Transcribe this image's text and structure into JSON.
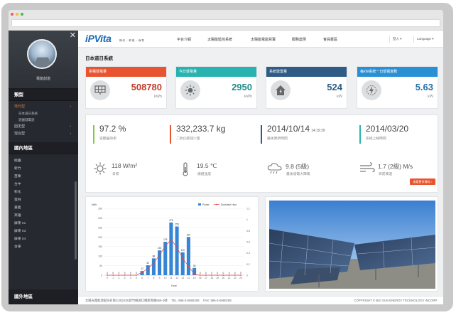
{
  "colors": {
    "accent_red": "#e8542f",
    "accent_teal": "#28b3b0",
    "accent_navy": "#2e5c86",
    "accent_blue": "#2a90d6",
    "bar_blue": "#3585d5",
    "line_red": "#e04646",
    "brand_blue": "#1a6ab5"
  },
  "sidebar": {
    "site_name": "電能創道",
    "section_type": "類型",
    "type_items": [
      {
        "label": "地日型",
        "sub": [
          "日本道日系統",
          "遊園儲電遊"
        ]
      },
      {
        "label": "固定型"
      },
      {
        "label": "混合型"
      }
    ],
    "section_domestic": "國內地區",
    "regions": [
      "桃園",
      "新竹",
      "苗栗",
      "台中",
      "彰化",
      "雲林",
      "嘉義",
      "高雄",
      "屏東 01",
      "屏東 03",
      "屏東 04",
      "台東"
    ],
    "section_overseas": "國外地區"
  },
  "topnav": {
    "logo": "iPVita",
    "logo_tagline": "節 約 ・ 節 能 ・ 綠 電",
    "items": [
      "平台介紹",
      "太陽能監控系統",
      "太陽能電能買賣",
      "服務案例",
      "會員專區"
    ],
    "login": "登入 ▾",
    "language": "Language ▾"
  },
  "page_title": "日本道日系統",
  "tiles": [
    {
      "title": "累積發電量",
      "value": "508780",
      "unit": "kWh",
      "color": "#e8542f",
      "value_color": "#c43a2a",
      "icon": "solar-panel-icon"
    },
    {
      "title": "今日發電量",
      "value": "2950",
      "unit": "kWh",
      "color": "#28b3b0",
      "value_color": "#1f8c89",
      "icon": "sun-icon"
    },
    {
      "title": "系統建置量",
      "value": "524",
      "unit": "kW",
      "color": "#2e5c86",
      "value_color": "#2e5c86",
      "icon": "house-icon"
    },
    {
      "title": "每kW系統一日發電度數",
      "value": "5.63",
      "unit": "kW",
      "color": "#2a90d6",
      "value_color": "#2470a8",
      "icon": "lightning-icon"
    }
  ],
  "stats": [
    {
      "value": "97.2 %",
      "time": "",
      "label": "逆變器效率",
      "color": "#8bc34a"
    },
    {
      "value": "332,233.7 kg",
      "time": "",
      "label": "二氧化碳減少量",
      "color": "#e8542f"
    },
    {
      "value": "2014/10/14",
      "time": "14:19:39",
      "label": "最後更新時間",
      "color": "#2e5c86"
    },
    {
      "value": "2014/03/20",
      "time": "",
      "label": "系統上線時間",
      "color": "#28b3b0"
    }
  ],
  "weather": [
    {
      "value": "118 W/m²",
      "label": "日照",
      "icon": "sun-outline-icon"
    },
    {
      "value": "19.5 ℃",
      "label": "模組溫度",
      "icon": "thermometer-icon"
    },
    {
      "value": "9.8 (5級)",
      "label": "最後發電大陣風",
      "icon": "cloud-rain-icon"
    },
    {
      "value": "1.7 (2級) M/s",
      "label": "目前風速",
      "icon": "wind-icon"
    }
  ],
  "more_button": "查看更多資料 ›",
  "chart_data": {
    "type": "bar",
    "title": "",
    "ylabel": "kWh",
    "xlabel": "Hour",
    "ylim": [
      0,
      350
    ],
    "y2lim": [
      0,
      1.2
    ],
    "legend": {
      "placement": "top-right"
    },
    "categories": [
      "0",
      "1",
      "2",
      "3",
      "4",
      "5",
      "6",
      "7",
      "8",
      "9",
      "10",
      "11",
      "12",
      "13",
      "14",
      "15",
      "16",
      "17",
      "18",
      "19",
      "20",
      "21",
      "22",
      "23"
    ],
    "series": [
      {
        "name": "Power",
        "type": "bar",
        "values": [
          0,
          0,
          0,
          0,
          0,
          0,
          22,
          52,
          88,
          130,
          175,
          276,
          255,
          120,
          200,
          38,
          0,
          0,
          0,
          0,
          0,
          0,
          0,
          0
        ]
      },
      {
        "name": "Sunshine Hour",
        "type": "line",
        "axis": "right",
        "values": [
          0,
          0,
          0,
          0,
          0,
          0,
          0.05,
          0.12,
          0.22,
          0.36,
          0.52,
          0.64,
          0.5,
          0.3,
          0.16,
          0.02,
          0,
          0,
          0,
          0,
          0,
          0,
          0,
          0
        ]
      }
    ],
    "yticks": [
      "0",
      "50",
      "100",
      "150",
      "200",
      "250",
      "300",
      "350"
    ],
    "y2ticks": [
      "0",
      "0.2",
      "0.4",
      "0.6",
      "0.8",
      "1",
      "1.2"
    ]
  },
  "footer": {
    "left": "太陽光電能源股份有限公司(300)新竹縣湖口鄉新興路568-3號　 TEL: 886-3-5990289　 FAX: 886-3-5990289",
    "right": "COPYRIGHT © BIG SUN ENERGY TECHNOLOGY INCORP."
  }
}
